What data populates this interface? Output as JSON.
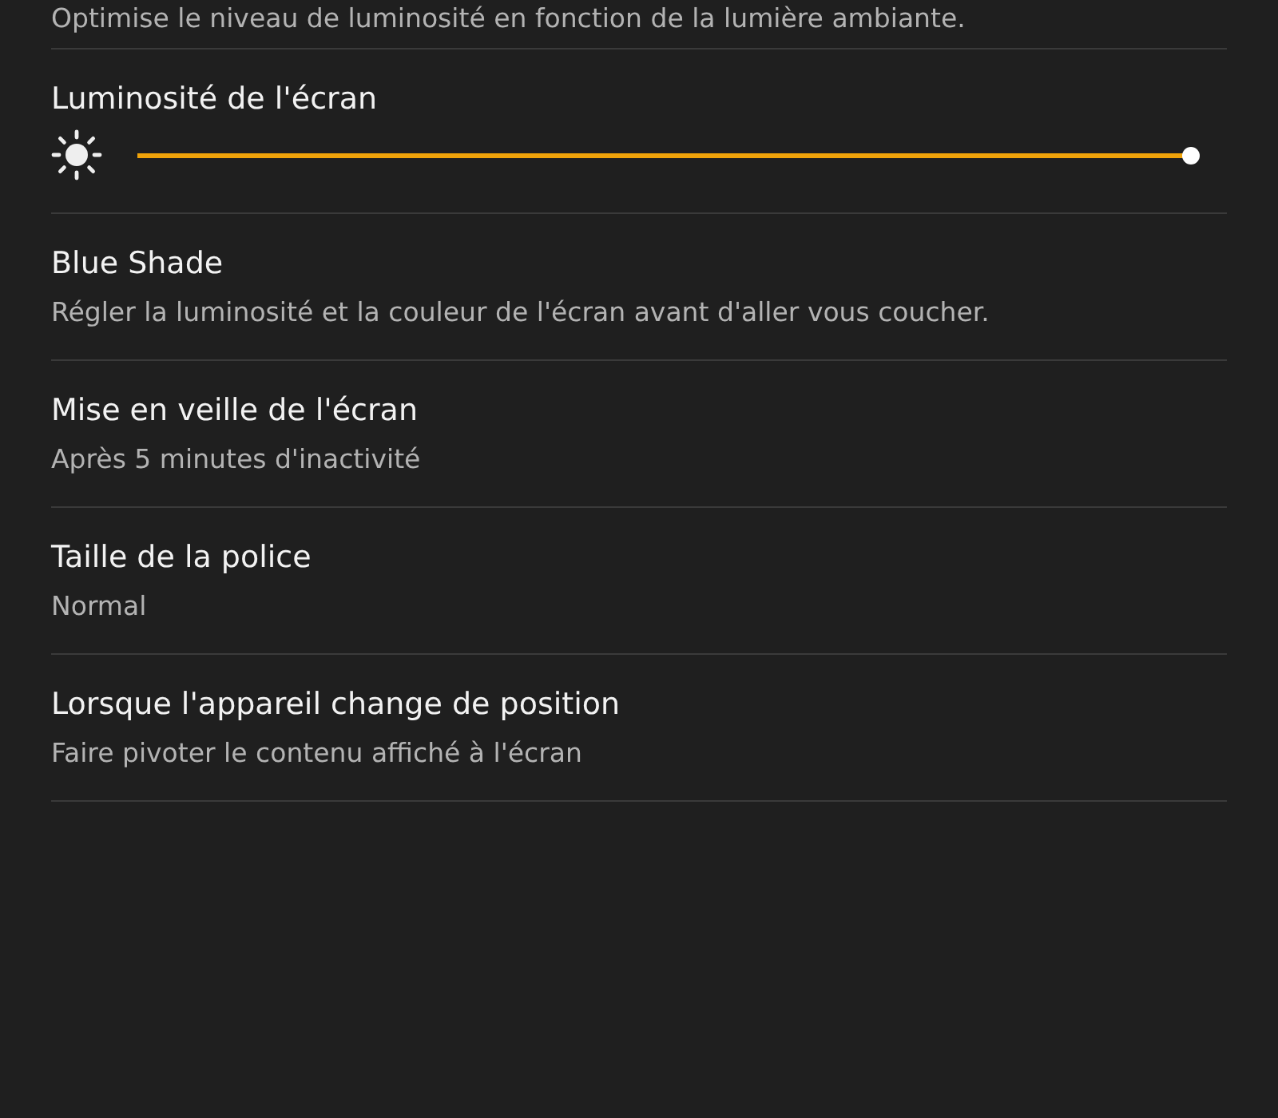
{
  "settings": [
    {
      "kind": "text",
      "subtitle": "Optimise le niveau de luminosité en fonction de la lumière ambiante."
    },
    {
      "kind": "slider",
      "title": "Luminosité de l'écran",
      "level": 1.0
    },
    {
      "kind": "text",
      "title": "Blue Shade",
      "subtitle": "Régler la luminosité et la couleur de l'écran avant d'aller vous coucher."
    },
    {
      "kind": "text",
      "title": "Mise en veille de l'écran",
      "subtitle": "Après 5 minutes d'inactivité"
    },
    {
      "kind": "text",
      "title": "Taille de la police",
      "subtitle": "Normal"
    },
    {
      "kind": "text",
      "title": "Lorsque l'appareil change de position",
      "subtitle": "Faire pivoter le contenu affiché à l'écran"
    }
  ]
}
